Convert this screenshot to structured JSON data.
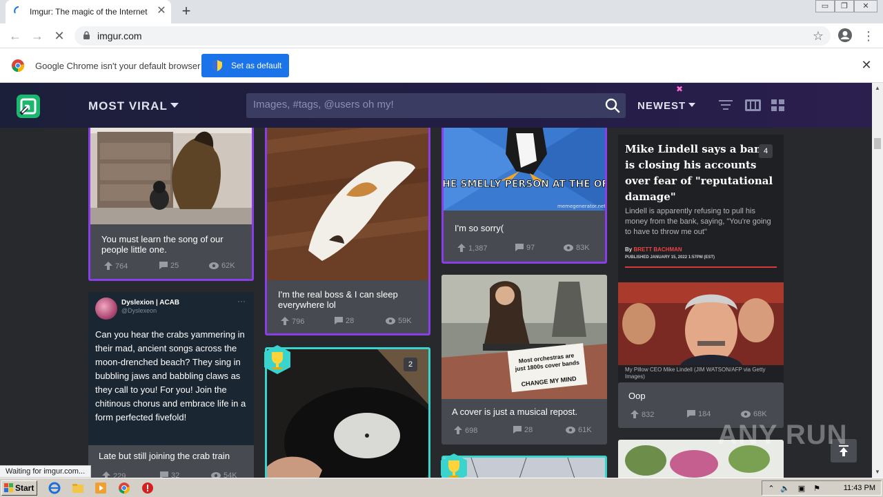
{
  "browser": {
    "tab_title": "Imgur: The magic of the Internet",
    "tab_close": "✕",
    "new_tab": "+",
    "url": "imgur.com",
    "status": "Waiting for imgur.com...",
    "infobar_text": "Google Chrome isn't your default browser",
    "infobar_button": "Set as default",
    "infobar_close": "✕"
  },
  "header": {
    "section": "MOST VIRAL",
    "search_placeholder": "Images, #tags, @users oh my!",
    "sort": "NEWEST"
  },
  "posts": [
    {
      "id": "dog",
      "title_lines": [
        "You must learn the song of our",
        "people little one."
      ],
      "upvotes": "764",
      "comments": "25",
      "views": "62K"
    },
    {
      "id": "cat",
      "title_lines": [
        "I'm the real boss & I can sleep",
        "everywhere lol"
      ],
      "upvotes": "796",
      "comments": "28",
      "views": "59K"
    },
    {
      "id": "penguin",
      "meme_text": "I'M THE SMELLY PERSON AT THE OFFICE",
      "meme_watermark": "memegenerator.net",
      "title_lines": [
        "I'm so sorry("
      ],
      "upvotes": "1,387",
      "comments": "97",
      "views": "83K"
    },
    {
      "id": "orchestra",
      "sign_lines": [
        "Most orchestras are",
        "just 1800s cover bands"
      ],
      "sign_bottom": "CHANGE MY MIND",
      "title_lines": [
        "A cover is just a musical repost."
      ],
      "upvotes": "698",
      "comments": "28",
      "views": "61K"
    },
    {
      "id": "oop",
      "title_lines": [
        "Oop"
      ],
      "upvotes": "832",
      "comments": "184",
      "views": "68K",
      "badge": "4"
    },
    {
      "id": "record",
      "badge": "2"
    },
    {
      "id": "crab",
      "title_lines": [
        "Late but still joining the crab train"
      ],
      "upvotes": "229",
      "comments": "32",
      "views": "54K"
    }
  ],
  "tweet": {
    "name": "Dyslexion | ACAB",
    "handle": "@Dyslexeon",
    "more": "···",
    "text": "Can you hear the crabs yammering in their mad, ancient songs across the moon-drenched beach? They sing in bubbling jaws and babbling claws as they call to you! For you! Join the chitinous chorus and embrace life in a form perfected fivefold!"
  },
  "article": {
    "headline": "Mike Lindell says a bank is closing his accounts over fear of \"reputational damage\"",
    "sub": "Lindell is apparently refusing to pull his money from the bank, saying, \"You're going to have to throw me out\"",
    "by_prefix": "By ",
    "author": "BRETT BACHMAN",
    "published": "PUBLISHED JANUARY 15, 2022 1:57PM (EST)",
    "caption": "My Pillow CEO Mike Lindell (JIM WATSON/AFP via Getty Images)"
  },
  "watermark": "ANY RUN",
  "taskbar": {
    "start": "Start",
    "time": "11:43 PM"
  },
  "colors": {
    "accent_purple": "#8a3ee8",
    "accent_teal": "#3ad4ce",
    "chrome_blue": "#1a73e8",
    "imgur_green": "#1bb76e"
  }
}
